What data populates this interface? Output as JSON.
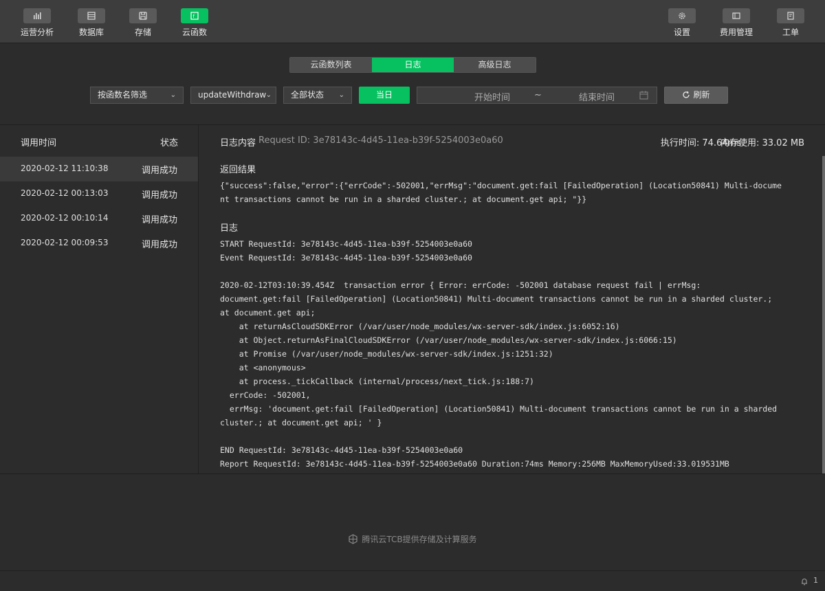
{
  "toolbar": {
    "left": [
      {
        "label": "运营分析",
        "icon": "chart-bar-icon"
      },
      {
        "label": "数据库",
        "icon": "database-icon"
      },
      {
        "label": "存储",
        "icon": "save-icon"
      },
      {
        "label": "云函数",
        "icon": "cloud-function-icon",
        "active": true
      }
    ],
    "right": [
      {
        "label": "设置",
        "icon": "gear-icon"
      },
      {
        "label": "费用管理",
        "icon": "billing-icon"
      },
      {
        "label": "工单",
        "icon": "ticket-icon"
      }
    ]
  },
  "tabs": [
    {
      "label": "云函数列表"
    },
    {
      "label": "日志",
      "active": true
    },
    {
      "label": "高级日志"
    }
  ],
  "filters": {
    "function_filter": "按函数名筛选",
    "function_name": "updateWithdraw",
    "status_filter": "全部状态",
    "today": "当日",
    "start_time": "开始时间",
    "separator": "~",
    "end_time": "结束时间",
    "refresh": "刷新"
  },
  "left_panel": {
    "col_time": "调用时间",
    "col_status": "状态",
    "rows": [
      {
        "time": "2020-02-12 11:10:38",
        "status": "调用成功"
      },
      {
        "time": "2020-02-12 00:13:03",
        "status": "调用成功"
      },
      {
        "time": "2020-02-12 00:10:14",
        "status": "调用成功"
      },
      {
        "time": "2020-02-12 00:09:53",
        "status": "调用成功"
      }
    ]
  },
  "log": {
    "title": "日志内容",
    "request_id": "Request ID: 3e78143c-4d45-11ea-b39f-5254003e0a60",
    "exec_time": "执行时间: 74.64ms",
    "memory": "内存使用: 33.02 MB",
    "result_title": "返回结果",
    "result_lines": [
      "{\"success\":false,\"error\":{\"errCode\":-502001,\"errMsg\":\"document.get:fail [FailedOperation] (Location50841) Multi-docume",
      "nt transactions cannot be run in a sharded cluster.; at document.get api; \"}}"
    ],
    "log_title": "日志",
    "log_lines": [
      "START RequestId: 3e78143c-4d45-11ea-b39f-5254003e0a60",
      "Event RequestId: 3e78143c-4d45-11ea-b39f-5254003e0a60",
      "",
      "2020-02-12T03:10:39.454Z  transaction error { Error: errCode: -502001 database request fail | errMsg:",
      "document.get:fail [FailedOperation] (Location50841) Multi-document transactions cannot be run in a sharded cluster.;",
      "at document.get api;",
      "    at returnAsCloudSDKError (/var/user/node_modules/wx-server-sdk/index.js:6052:16)",
      "    at Object.returnAsFinalCloudSDKError (/var/user/node_modules/wx-server-sdk/index.js:6066:15)",
      "    at Promise (/var/user/node_modules/wx-server-sdk/index.js:1251:32)",
      "    at <anonymous>",
      "    at process._tickCallback (internal/process/next_tick.js:188:7)",
      "  errCode: -502001,",
      "  errMsg: 'document.get:fail [FailedOperation] (Location50841) Multi-document transactions cannot be run in a sharded",
      "cluster.; at document.get api; ' }",
      "",
      "END RequestId: 3e78143c-4d45-11ea-b39f-5254003e0a60",
      "Report RequestId: 3e78143c-4d45-11ea-b39f-5254003e0a60 Duration:74ms Memory:256MB MaxMemoryUsed:33.019531MB"
    ]
  },
  "footer": {
    "text": "腾讯云TCB提供存储及计算服务",
    "notification_count": "1"
  },
  "colors": {
    "accent": "#07c160",
    "background": "#2c2c2c",
    "toolbar": "#3d3d3d"
  }
}
